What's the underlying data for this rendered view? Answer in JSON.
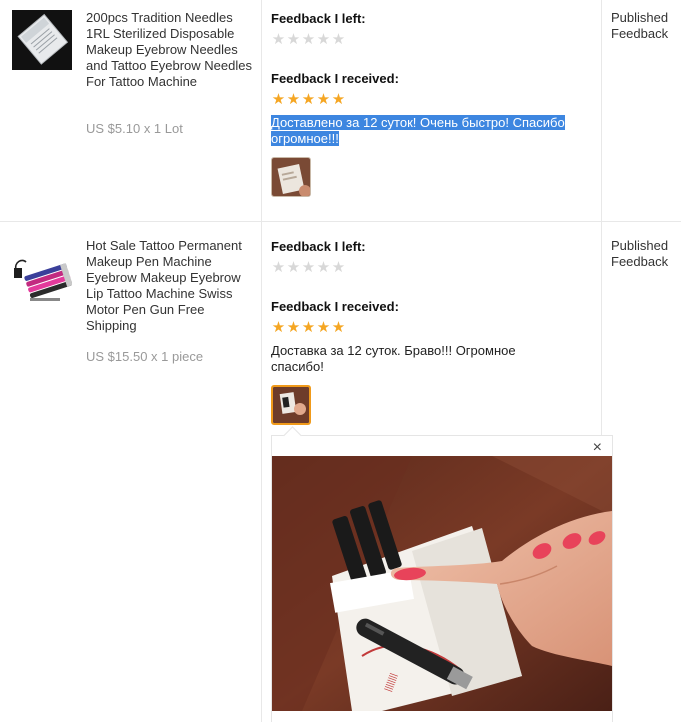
{
  "orders": [
    {
      "product": {
        "title": "200pcs Tradition Needles 1RL Sterilized Disposable Makeup Eyebrow Needles and Tattoo Eyebrow Needles For Tattoo Machine",
        "price": "US $5.10 x 1 Lot",
        "image_icon": "needles-package-image"
      },
      "feedback_left": {
        "label": "Feedback I left:",
        "rating": 0
      },
      "feedback_received": {
        "label": "Feedback I received:",
        "rating": 5,
        "comment": "Доставлено за 12 суток! Очень быстро! Спасибо огромное!!!",
        "comment_selected": true
      },
      "status": "Published Feedback"
    },
    {
      "product": {
        "title": "Hot Sale Tattoo Permanent Makeup Pen Machine Eyebrow Makeup Eyebrow Lip Tattoo Machine Swiss Motor Pen Gun Free Shipping",
        "price": "US $15.50 x 1 piece",
        "image_icon": "tattoo-pen-machines-image"
      },
      "feedback_left": {
        "label": "Feedback I left:",
        "rating": 0
      },
      "feedback_received": {
        "label": "Feedback I received:",
        "rating": 5,
        "comment": "Доставка за 12 суток. Браво!!! Огромное спасибо!",
        "comment_selected": false
      },
      "status": "Published Feedback"
    }
  ],
  "popup": {
    "close_symbol": "×",
    "image_icon": "feedback-photo-hand-holding-needles"
  },
  "colors": {
    "star_on": "#f5a623",
    "star_off": "#d8d8d8",
    "selection": "#3d86e0",
    "price": "#999999"
  }
}
